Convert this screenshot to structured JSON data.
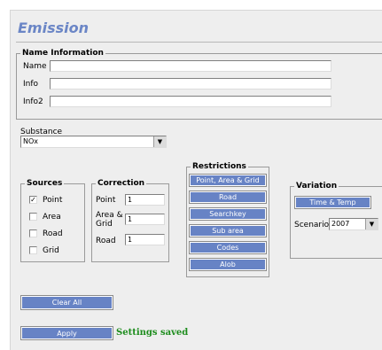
{
  "page": {
    "title": "Emission"
  },
  "name_information": {
    "legend": "Name Information",
    "fields": [
      {
        "label": "Name",
        "value": ""
      },
      {
        "label": "Info",
        "value": ""
      },
      {
        "label": "Info2",
        "value": ""
      }
    ]
  },
  "substance": {
    "label": "Substance",
    "selected": "NOx"
  },
  "sources": {
    "legend": "Sources",
    "items": [
      {
        "label": "Point",
        "checked": true,
        "mark": "✓"
      },
      {
        "label": "Area",
        "checked": false,
        "mark": ""
      },
      {
        "label": "Road",
        "checked": false,
        "mark": ""
      },
      {
        "label": "Grid",
        "checked": false,
        "mark": ""
      }
    ]
  },
  "correction": {
    "legend": "Correction",
    "rows": [
      {
        "label": "Point",
        "value": "1"
      },
      {
        "label_line1": "Area &",
        "label_line2": "Grid",
        "value": "1"
      },
      {
        "label": "Road",
        "value": "1"
      }
    ]
  },
  "restrictions": {
    "legend": "Restrictions",
    "buttons": [
      "Point, Area & Grid",
      "Road",
      "Searchkey",
      "Sub area",
      "Codes",
      "Alob"
    ]
  },
  "variation": {
    "legend": "Variation",
    "button": "Time & Temp",
    "scenario_label": "Scenario",
    "scenario_value": "2007"
  },
  "actions": {
    "clear_all": "Clear All",
    "apply": "Apply",
    "status": "Settings saved"
  },
  "colors": {
    "accent": "#6783c5",
    "title": "#6b86c6",
    "status": "#1c8c1c",
    "panel": "#eeeeee"
  }
}
